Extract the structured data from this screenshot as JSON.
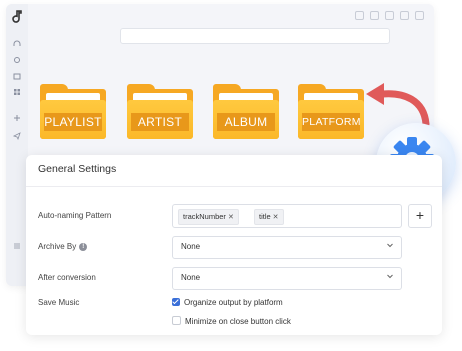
{
  "folders": [
    {
      "label": "PLAYLIST"
    },
    {
      "label": "ARTIST"
    },
    {
      "label": "ALBUM"
    },
    {
      "label": "PLATFORM"
    }
  ],
  "panel": {
    "title": "General Settings",
    "auto_naming": {
      "label": "Auto-naming Pattern",
      "tags": [
        "trackNumber",
        "title"
      ],
      "add_label": "+"
    },
    "archive_by": {
      "label": "Archive By",
      "value": "None"
    },
    "after_conversion": {
      "label": "After conversion",
      "value": "None"
    },
    "save_music": {
      "label": "Save Music",
      "organize_label": "Organize output by platform",
      "organize_checked": true,
      "minimize_label": "Minimize on close button click",
      "minimize_checked": false
    }
  },
  "colors": {
    "folder": "#f6a823",
    "accent": "#3a6fd8",
    "arrow": "#e05a5a",
    "gear": "#3a86f0"
  }
}
